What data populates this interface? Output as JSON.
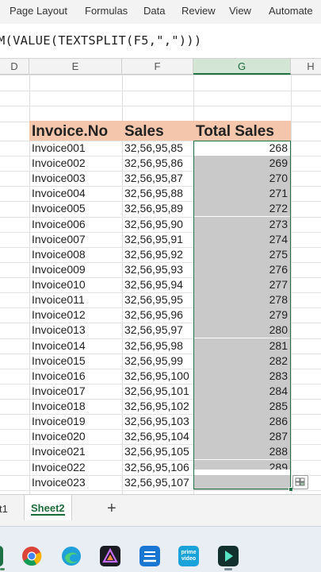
{
  "ribbon": {
    "tabs": [
      "Page Layout",
      "Formulas",
      "Data",
      "Review",
      "View",
      "Automate"
    ]
  },
  "formula_bar": {
    "text": "M(VALUE(TEXTSPLIT(F5,\",\")))"
  },
  "columns": {
    "labels": [
      "D",
      "E",
      "F",
      "G",
      "H"
    ],
    "selected": "G"
  },
  "table": {
    "headers": [
      "Invoice.No",
      "Sales",
      "Total Sales"
    ],
    "rows": [
      {
        "invoice": "Invoice001",
        "sales": "32,56,95,85",
        "total": "268"
      },
      {
        "invoice": "Invoice002",
        "sales": "32,56,95,86",
        "total": "269"
      },
      {
        "invoice": "Invoice003",
        "sales": "32,56,95,87",
        "total": "270"
      },
      {
        "invoice": "Invoice004",
        "sales": "32,56,95,88",
        "total": "271"
      },
      {
        "invoice": "Invoice005",
        "sales": "32,56,95,89",
        "total": "272"
      },
      {
        "invoice": "Invoice006",
        "sales": "32,56,95,90",
        "total": "273"
      },
      {
        "invoice": "Invoice007",
        "sales": "32,56,95,91",
        "total": "274"
      },
      {
        "invoice": "Invoice008",
        "sales": "32,56,95,92",
        "total": "275"
      },
      {
        "invoice": "Invoice009",
        "sales": "32,56,95,93",
        "total": "276"
      },
      {
        "invoice": "Invoice010",
        "sales": "32,56,95,94",
        "total": "277"
      },
      {
        "invoice": "Invoice011",
        "sales": "32,56,95,95",
        "total": "278"
      },
      {
        "invoice": "Invoice012",
        "sales": "32,56,95,96",
        "total": "279"
      },
      {
        "invoice": "Invoice013",
        "sales": "32,56,95,97",
        "total": "280"
      },
      {
        "invoice": "Invoice014",
        "sales": "32,56,95,98",
        "total": "281"
      },
      {
        "invoice": "Invoice015",
        "sales": "32,56,95,99",
        "total": "282"
      },
      {
        "invoice": "Invoice016",
        "sales": "32,56,95,100",
        "total": "283"
      },
      {
        "invoice": "Invoice017",
        "sales": "32,56,95,101",
        "total": "284"
      },
      {
        "invoice": "Invoice018",
        "sales": "32,56,95,102",
        "total": "285"
      },
      {
        "invoice": "Invoice019",
        "sales": "32,56,95,103",
        "total": "286"
      },
      {
        "invoice": "Invoice020",
        "sales": "32,56,95,104",
        "total": "287"
      },
      {
        "invoice": "Invoice021",
        "sales": "32,56,95,105",
        "total": "288"
      },
      {
        "invoice": "Invoice022",
        "sales": "32,56,95,106",
        "total": "289"
      },
      {
        "invoice": "Invoice023",
        "sales": "32,56,95,107",
        "total": ""
      }
    ]
  },
  "sheet_tabs": {
    "previous": "t1",
    "active": "Sheet2",
    "add_label": "+"
  },
  "taskbar": {
    "apps": [
      "excel-icon",
      "chrome-icon",
      "edge-icon",
      "affinity-icon",
      "file-upload-icon",
      "prime-video-icon",
      "filmora-icon"
    ],
    "prime_label": "prime video",
    "colors": {
      "excel": "#1e7145",
      "chrome_red": "#db4437",
      "chrome_yellow": "#f4b400",
      "chrome_green": "#0f9d58",
      "chrome_blue": "#4285f4",
      "edge": "#1fa0d8",
      "affinity": "#1b1b24",
      "upload": "#1976d2",
      "prime": "#1aa3d9",
      "filmora": "#12302e"
    }
  },
  "accent": {
    "header_fill": "#f4c7ad",
    "selection": "#217346",
    "selected_fill": "#c9c9c9"
  }
}
